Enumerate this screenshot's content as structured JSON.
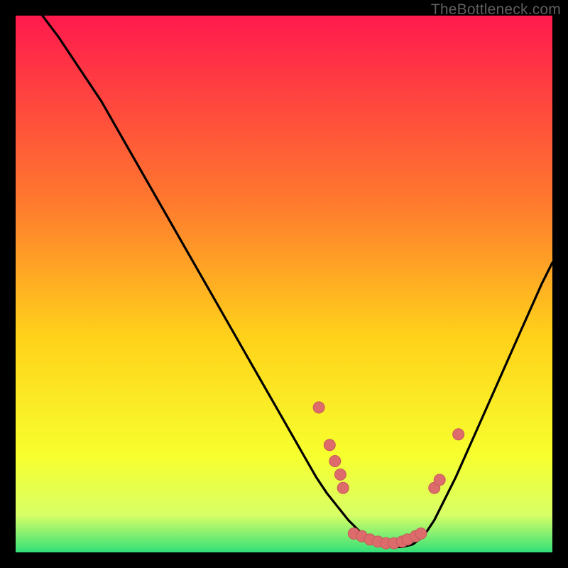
{
  "attribution": "TheBottleneck.com",
  "colors": {
    "bg": "#000000",
    "grad_top": "#ff1a4d",
    "grad_mid1": "#ff7a2e",
    "grad_mid2": "#ffd21a",
    "grad_low1": "#f7ff2e",
    "grad_low2": "#d8ff66",
    "grad_bottom": "#33e079",
    "curve": "#000000",
    "dot_fill": "#dd6b6b",
    "dot_stroke": "#c45a5a"
  },
  "chart_data": {
    "type": "line",
    "title": "",
    "xlabel": "",
    "ylabel": "",
    "xlim": [
      0,
      100
    ],
    "ylim": [
      0,
      100
    ],
    "curve": {
      "x": [
        5,
        8,
        12,
        16,
        20,
        24,
        28,
        32,
        36,
        40,
        44,
        48,
        52,
        56,
        58,
        60,
        62,
        64,
        66,
        68,
        70,
        72,
        74,
        76,
        78,
        82,
        86,
        90,
        94,
        98,
        100
      ],
      "y": [
        100,
        96,
        90,
        84,
        77,
        70,
        63,
        56,
        49,
        42,
        35,
        28,
        21,
        14,
        11,
        8.5,
        6,
        4,
        2.5,
        1.5,
        1,
        1,
        1.5,
        3,
        6,
        14,
        23,
        32,
        41,
        50,
        54
      ]
    },
    "dots": [
      {
        "x": 56.5,
        "y": 27
      },
      {
        "x": 58.5,
        "y": 20
      },
      {
        "x": 59.5,
        "y": 17
      },
      {
        "x": 60.5,
        "y": 14.5
      },
      {
        "x": 61,
        "y": 12
      },
      {
        "x": 63,
        "y": 3.5
      },
      {
        "x": 64.5,
        "y": 3
      },
      {
        "x": 66,
        "y": 2.4
      },
      {
        "x": 67.5,
        "y": 2
      },
      {
        "x": 69,
        "y": 1.7
      },
      {
        "x": 70.5,
        "y": 1.7
      },
      {
        "x": 72,
        "y": 2
      },
      {
        "x": 73,
        "y": 2.4
      },
      {
        "x": 74.5,
        "y": 3
      },
      {
        "x": 75.5,
        "y": 3.5
      },
      {
        "x": 78,
        "y": 12
      },
      {
        "x": 79,
        "y": 13.5
      },
      {
        "x": 82.5,
        "y": 22
      }
    ]
  }
}
